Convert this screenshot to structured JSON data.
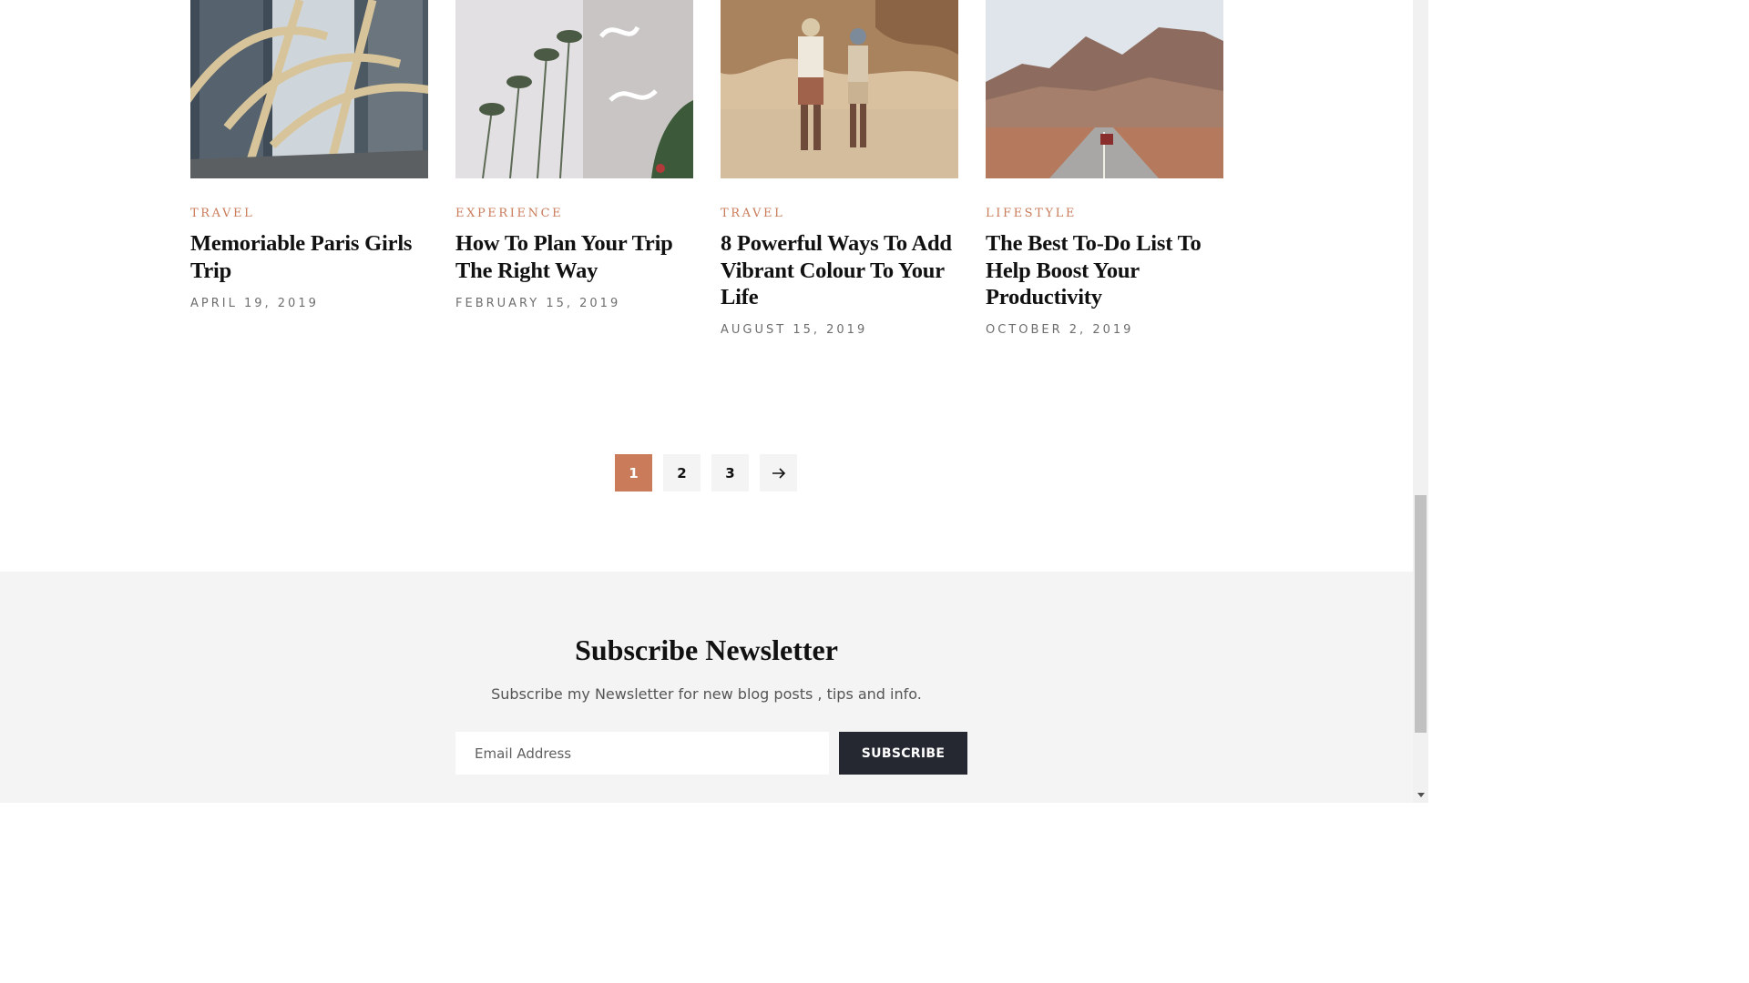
{
  "posts": [
    {
      "category": "TRAVEL",
      "title": "Memoriable Paris Girls Trip",
      "date": "APRIL 19, 2019"
    },
    {
      "category": "EXPERIENCE",
      "title": "How To Plan Your Trip The Right Way",
      "date": "FEBRUARY 15, 2019"
    },
    {
      "category": "TRAVEL",
      "title": "8 Powerful Ways To Add Vibrant Colour To Your Life",
      "date": "AUGUST 15, 2019"
    },
    {
      "category": "LIFESTYLE",
      "title": "The Best To-Do List To Help Boost Your Productivity",
      "date": "OCTOBER 2, 2019"
    }
  ],
  "pagination": {
    "pages": [
      "1",
      "2",
      "3"
    ],
    "current": "1",
    "next_icon": "arrow-right-icon"
  },
  "newsletter": {
    "title": "Subscribe Newsletter",
    "subtitle": "Subscribe my Newsletter for new blog posts , tips and info.",
    "email_placeholder": "Email Address",
    "button_label": "SUBSCRIBE"
  },
  "colors": {
    "accent": "#c97b5a",
    "dark": "#252831",
    "section_bg": "#f4f4f4"
  }
}
